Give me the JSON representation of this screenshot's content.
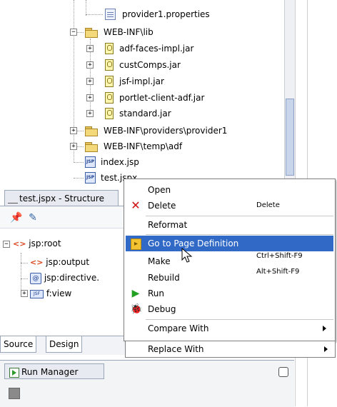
{
  "project_tree": {
    "items": [
      {
        "label": "provider1.properties",
        "icon": "properties-file-icon"
      },
      {
        "label": "WEB-INF\\lib",
        "icon": "folder-icon"
      },
      {
        "label": "adf-faces-impl.jar",
        "icon": "jar-icon"
      },
      {
        "label": "custComps.jar",
        "icon": "jar-icon"
      },
      {
        "label": "jsf-impl.jar",
        "icon": "jar-icon"
      },
      {
        "label": "portlet-client-adf.jar",
        "icon": "jar-icon"
      },
      {
        "label": "standard.jar",
        "icon": "jar-icon"
      },
      {
        "label": "WEB-INF\\providers\\provider1",
        "icon": "folder-icon"
      },
      {
        "label": "WEB-INF\\temp\\adf",
        "icon": "folder-icon"
      },
      {
        "label": "index.jsp",
        "icon": "jsp-file-icon"
      },
      {
        "label": "test.jspx",
        "icon": "jsp-file-icon"
      }
    ]
  },
  "structure": {
    "tab_title": "test.jspx - Structure",
    "items": [
      {
        "label": "jsp:root"
      },
      {
        "label": "jsp:output"
      },
      {
        "label": "jsp:directive."
      },
      {
        "label": "f:view"
      }
    ],
    "tabs": [
      "Source",
      "Design"
    ]
  },
  "run_manager": {
    "title": "Run Manager"
  },
  "context_menu": {
    "items": [
      {
        "label": "Open",
        "shortcut": ""
      },
      {
        "label": "Delete",
        "shortcut": "Delete",
        "icon": "delete-icon"
      },
      {
        "label": "Reformat",
        "shortcut": ""
      },
      {
        "label": "Go to Page Definition",
        "shortcut": "",
        "icon": "page-definition-icon",
        "selected": true
      },
      {
        "label": "Make",
        "shortcut": "Ctrl+Shift-F9"
      },
      {
        "label": "Rebuild",
        "shortcut": "Alt+Shift-F9"
      },
      {
        "label": "Run",
        "shortcut": "",
        "icon": "run-icon"
      },
      {
        "label": "Debug",
        "shortcut": "",
        "icon": "bug-icon"
      },
      {
        "label": "Compare With",
        "shortcut": "",
        "submenu": true
      },
      {
        "label": "Replace With",
        "shortcut": "",
        "submenu": true
      }
    ]
  },
  "colors": {
    "selection": "#3169c6",
    "panel_border": "#9aa6b8"
  }
}
